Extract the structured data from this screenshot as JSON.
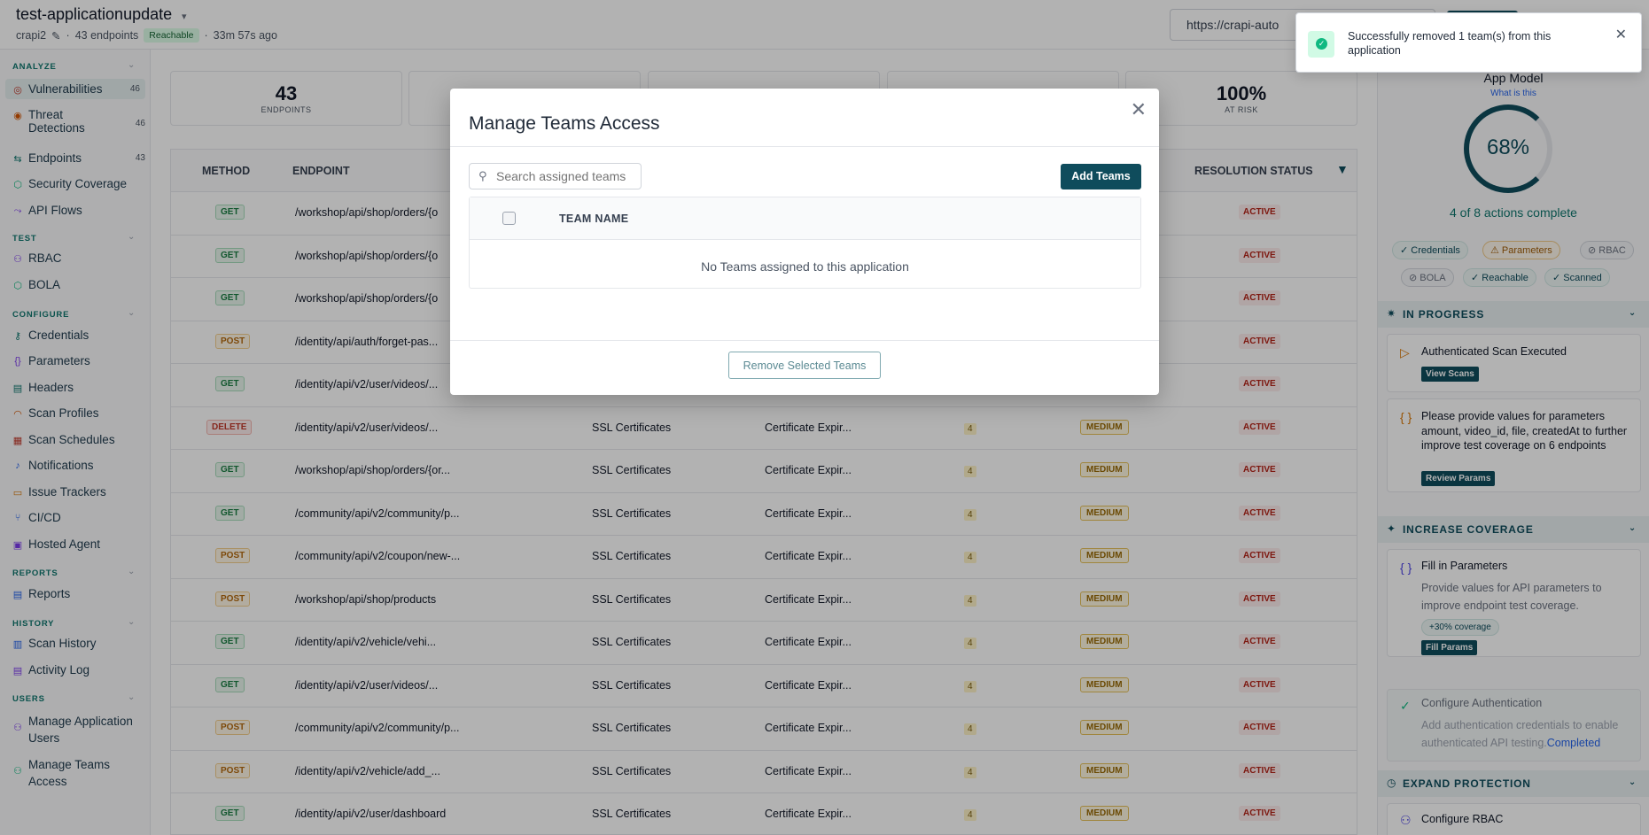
{
  "header": {
    "title": "test-applicationupdate",
    "project": "crapi2",
    "endpoints": "43 endpoints",
    "reachable": "Reachable",
    "ago": "33m 57s ago",
    "url": "https://crapi-auto"
  },
  "sidebar": {
    "sections": {
      "analyze": "ANALYZE",
      "test": "TEST",
      "configure": "CONFIGURE",
      "reports": "REPORTS",
      "history": "HISTORY",
      "users": "USERS"
    },
    "items": [
      {
        "label": "Vulnerabilities",
        "count": "46"
      },
      {
        "label": "Threat Detections",
        "count": "46"
      },
      {
        "label": "Endpoints",
        "count": "43"
      },
      {
        "label": "Security Coverage"
      },
      {
        "label": "API Flows"
      },
      {
        "label": "RBAC"
      },
      {
        "label": "BOLA"
      },
      {
        "label": "Credentials"
      },
      {
        "label": "Parameters"
      },
      {
        "label": "Headers"
      },
      {
        "label": "Scan Profiles"
      },
      {
        "label": "Scan Schedules"
      },
      {
        "label": "Notifications"
      },
      {
        "label": "Issue Trackers"
      },
      {
        "label": "CI/CD"
      },
      {
        "label": "Hosted Agent"
      },
      {
        "label": "Reports"
      },
      {
        "label": "Scan History"
      },
      {
        "label": "Activity Log"
      },
      {
        "label": "Manage Application Users"
      },
      {
        "label": "Manage Teams Access"
      }
    ]
  },
  "stats": [
    {
      "value": "43",
      "label": "ENDPOINTS"
    },
    {
      "value": "100%",
      "label": "AT RISK"
    }
  ],
  "table": {
    "headers": {
      "method": "METHOD",
      "endpoint": "ENDPOINT",
      "status": "RESOLUTION STATUS"
    },
    "rows": [
      {
        "method": "GET",
        "endpoint": "/workshop/api/shop/orders/{o",
        "category": "",
        "vuln": "",
        "count": "",
        "severity": "",
        "status": "ACTIVE"
      },
      {
        "method": "GET",
        "endpoint": "/workshop/api/shop/orders/{o",
        "category": "",
        "vuln": "",
        "count": "",
        "severity": "",
        "status": "ACTIVE"
      },
      {
        "method": "GET",
        "endpoint": "/workshop/api/shop/orders/{o",
        "category": "",
        "vuln": "",
        "count": "",
        "severity": "",
        "status": "ACTIVE"
      },
      {
        "method": "POST",
        "endpoint": "/identity/api/auth/forget-pas...",
        "category": "",
        "vuln": "",
        "count": "",
        "severity": "",
        "status": "ACTIVE"
      },
      {
        "method": "GET",
        "endpoint": "/identity/api/v2/user/videos/...",
        "category": "",
        "vuln": "",
        "count": "",
        "severity": "",
        "status": "ACTIVE"
      },
      {
        "method": "DELETE",
        "endpoint": "/identity/api/v2/user/videos/...",
        "category": "SSL Certificates",
        "vuln": "Certificate Expir...",
        "count": "4",
        "severity": "MEDIUM",
        "status": "ACTIVE"
      },
      {
        "method": "GET",
        "endpoint": "/workshop/api/shop/orders/{or...",
        "category": "SSL Certificates",
        "vuln": "Certificate Expir...",
        "count": "4",
        "severity": "MEDIUM",
        "status": "ACTIVE"
      },
      {
        "method": "GET",
        "endpoint": "/community/api/v2/community/p...",
        "category": "SSL Certificates",
        "vuln": "Certificate Expir...",
        "count": "4",
        "severity": "MEDIUM",
        "status": "ACTIVE"
      },
      {
        "method": "POST",
        "endpoint": "/community/api/v2/coupon/new-...",
        "category": "SSL Certificates",
        "vuln": "Certificate Expir...",
        "count": "4",
        "severity": "MEDIUM",
        "status": "ACTIVE"
      },
      {
        "method": "POST",
        "endpoint": "/workshop/api/shop/products",
        "category": "SSL Certificates",
        "vuln": "Certificate Expir...",
        "count": "4",
        "severity": "MEDIUM",
        "status": "ACTIVE"
      },
      {
        "method": "GET",
        "endpoint": "/identity/api/v2/vehicle/vehi...",
        "category": "SSL Certificates",
        "vuln": "Certificate Expir...",
        "count": "4",
        "severity": "MEDIUM",
        "status": "ACTIVE"
      },
      {
        "method": "GET",
        "endpoint": "/identity/api/v2/user/videos/...",
        "category": "SSL Certificates",
        "vuln": "Certificate Expir...",
        "count": "4",
        "severity": "MEDIUM",
        "status": "ACTIVE"
      },
      {
        "method": "POST",
        "endpoint": "/community/api/v2/community/p...",
        "category": "SSL Certificates",
        "vuln": "Certificate Expir...",
        "count": "4",
        "severity": "MEDIUM",
        "status": "ACTIVE"
      },
      {
        "method": "POST",
        "endpoint": "/identity/api/v2/vehicle/add_...",
        "category": "SSL Certificates",
        "vuln": "Certificate Expir...",
        "count": "4",
        "severity": "MEDIUM",
        "status": "ACTIVE"
      },
      {
        "method": "GET",
        "endpoint": "/identity/api/v2/user/dashboard",
        "category": "SSL Certificates",
        "vuln": "Certificate Expir...",
        "count": "4",
        "severity": "MEDIUM",
        "status": "ACTIVE"
      }
    ]
  },
  "right_panel": {
    "app_model": "App Model",
    "what_is_this": "What is this",
    "percent": "68%",
    "actions_complete": "4 of 8 actions complete",
    "chips": [
      "Credentials",
      "Parameters",
      "RBAC",
      "BOLA",
      "Reachable",
      "Scanned"
    ],
    "in_progress": "IN PROGRESS",
    "auth_scan": "Authenticated Scan Executed",
    "view_scans": "View Scans",
    "params_msg": "Please provide values for parameters amount, video_id, file, createdAt to further improve test coverage on 6 endpoints",
    "review_params": "Review Params",
    "increase_coverage": "INCREASE COVERAGE",
    "fill_params_title": "Fill in Parameters",
    "fill_params_desc": "Provide values for API parameters to improve endpoint test coverage.",
    "coverage_chip": "+30% coverage",
    "fill_params_btn": "Fill Params",
    "config_auth_title": "Configure Authentication",
    "config_auth_desc": "Add authentication credentials to enable authenticated API testing.",
    "completed": "Completed",
    "expand_protection": "EXPAND PROTECTION",
    "config_rbac": "Configure RBAC"
  },
  "modal": {
    "title": "Manage Teams Access",
    "search_placeholder": "Search assigned teams",
    "add_teams": "Add Teams",
    "column_team_name": "TEAM NAME",
    "empty_message": "No Teams assigned to this application",
    "remove_selected": "Remove Selected Teams"
  },
  "toast": {
    "message": "Successfully removed 1 team(s) from this application"
  },
  "colors": {
    "brand": "#0f4c5c",
    "accent": "#0f766e",
    "success": "#10b981",
    "danger": "#b42318",
    "warning": "#9a6a06"
  }
}
